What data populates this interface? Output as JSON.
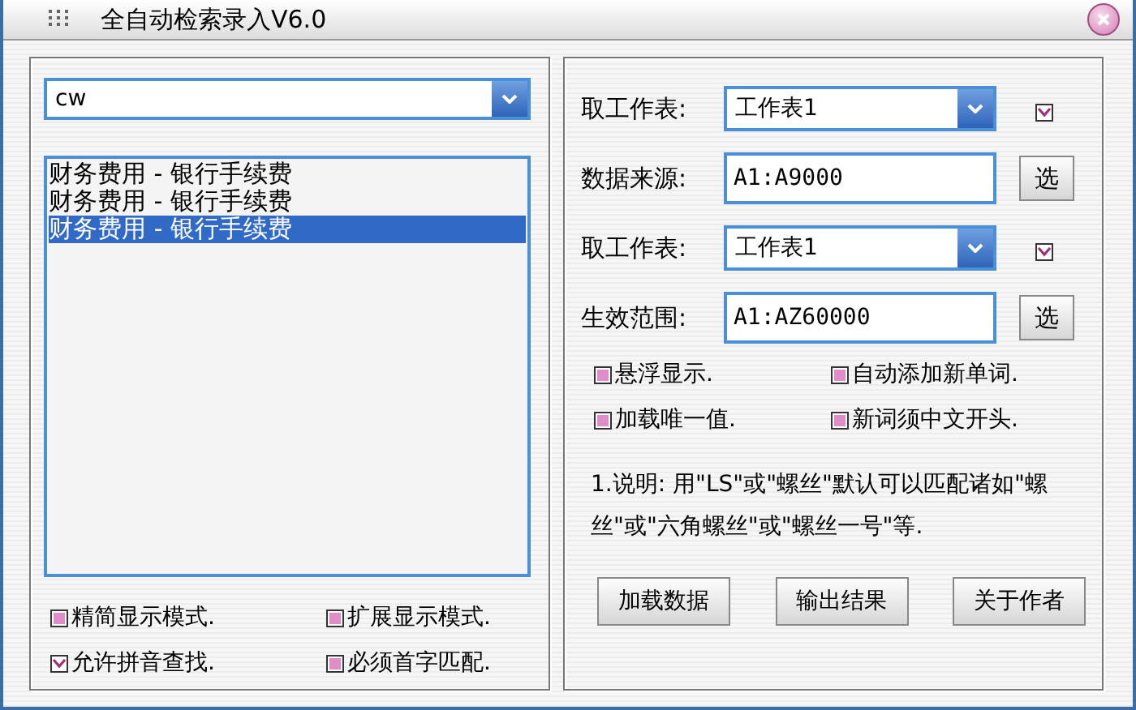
{
  "window": {
    "title": "全自动检索录入V6.0"
  },
  "left": {
    "search_combo": {
      "value": "cw"
    },
    "results": [
      {
        "text": "财务费用 - 银行手续费",
        "selected": false
      },
      {
        "text": "财务费用 - 银行手续费",
        "selected": false
      },
      {
        "text": "财务费用 - 银行手续费",
        "selected": true
      }
    ],
    "options": [
      {
        "label": "精简显示模式.",
        "checked": false
      },
      {
        "label": "扩展显示模式.",
        "checked": false
      },
      {
        "label": "允许拼音查找.",
        "checked": true
      },
      {
        "label": "必须首字匹配.",
        "checked": false
      }
    ]
  },
  "right": {
    "rows": [
      {
        "kind": "combo",
        "label": "取工作表:",
        "value": "工作表1",
        "checked": true
      },
      {
        "kind": "range",
        "label": "数据来源:",
        "value": "A1:A9000",
        "button": "选"
      },
      {
        "kind": "combo",
        "label": "取工作表:",
        "value": "工作表1",
        "checked": true
      },
      {
        "kind": "range",
        "label": "生效范围:",
        "value": "A1:AZ60000",
        "button": "选"
      }
    ],
    "options": [
      {
        "label": "悬浮显示.",
        "checked": false
      },
      {
        "label": "自动添加新单词.",
        "checked": false
      },
      {
        "label": "加载唯一值.",
        "checked": false
      },
      {
        "label": "新词须中文开头.",
        "checked": false
      }
    ],
    "note": "1.说明: 用\"LS\"或\"螺丝\"默认可以匹配诸如\"螺丝\"或\"六角螺丝\"或\"螺丝一号\"等.",
    "buttons": [
      "加载数据",
      "输出结果",
      "关于作者"
    ]
  }
}
